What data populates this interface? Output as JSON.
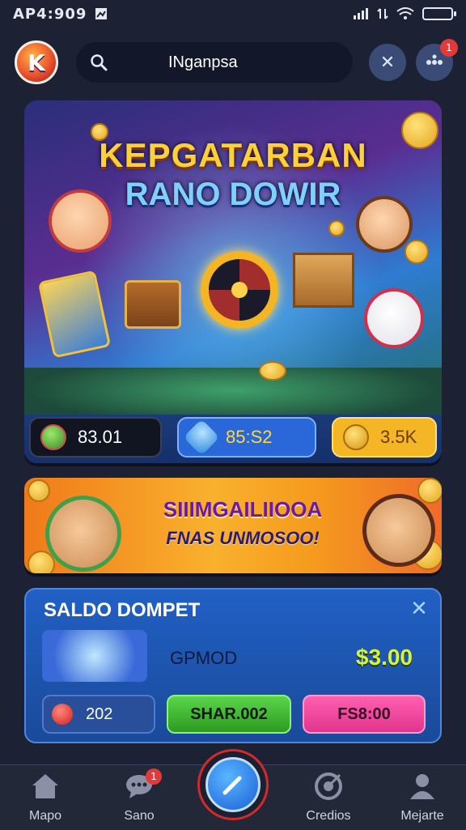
{
  "status_bar": {
    "time": "AP4:909"
  },
  "header": {
    "search_value": "INganpsa",
    "close_label": "✕",
    "menu_badge": "1"
  },
  "hero": {
    "title": "KEPGATARBAN",
    "subtitle": "RANO DOWIR",
    "stats": [
      {
        "value": "83.01"
      },
      {
        "value": "85:S2"
      },
      {
        "value": "3.5K"
      }
    ]
  },
  "promo": {
    "title": "SIIIMGAILIIOOA",
    "subtitle": "FNAS UNMOSOO!"
  },
  "wallet": {
    "title": "SALDO DOMPET",
    "game_name": "GPMOD",
    "amount": "$3.00",
    "count": "202",
    "primary_action": "SHAR.002",
    "secondary_action": "FS8:00"
  },
  "bottom_nav": {
    "items": [
      {
        "label": "Mapo"
      },
      {
        "label": "Sano",
        "badge": "1"
      },
      {
        "label": "Credios"
      },
      {
        "label": "Mejarte"
      }
    ]
  },
  "colors": {
    "background": "#1c2233",
    "accent_blue": "#2a67d8",
    "accent_gold": "#f4b624",
    "wallet_green": "#5ad64a",
    "wallet_pink": "#ff5fb0",
    "nav_ring": "#d12a2a"
  }
}
